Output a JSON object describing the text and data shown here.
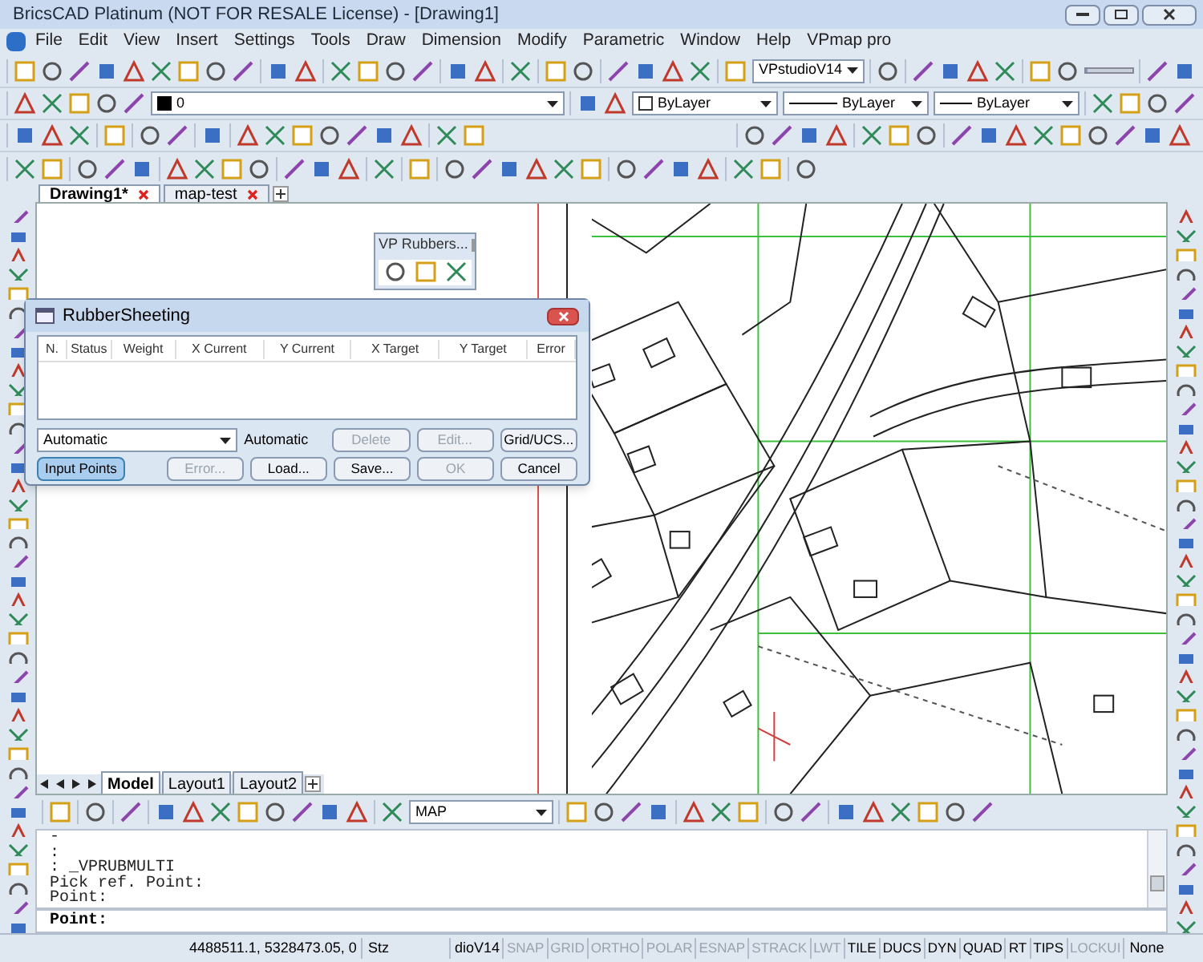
{
  "window": {
    "title": "BricsCAD Platinum (NOT FOR RESALE License) - [Drawing1]"
  },
  "menu": [
    "File",
    "Edit",
    "View",
    "Insert",
    "Settings",
    "Tools",
    "Draw",
    "Dimension",
    "Modify",
    "Parametric",
    "Window",
    "Help",
    "VPmap pro"
  ],
  "toolbar": {
    "style_dropdown": "VPstudioV14",
    "zoom_slider": {
      "level": 0.05
    },
    "layer_dropdown": "0",
    "color_dropdown": "ByLayer",
    "linetype_dropdown": "ByLayer",
    "lineweight_dropdown": "ByLayer"
  },
  "drawing_tabs": [
    {
      "label": "Drawing1*",
      "selected": true
    },
    {
      "label": "map-test",
      "selected": false
    }
  ],
  "floating_toolbar": {
    "title": "VP Rubbers..."
  },
  "dialog": {
    "title": "RubberSheeting",
    "columns": [
      "N.",
      "Status",
      "Weight",
      "X Current",
      "Y Current",
      "X Target",
      "Y Target",
      "Error"
    ],
    "mode_dropdown": "Automatic",
    "mode_label": "Automatic",
    "buttons_row_1": [
      {
        "label": "Delete",
        "disabled": true,
        "pressed": false
      },
      {
        "label": "Edit...",
        "disabled": true,
        "pressed": false
      },
      {
        "label": "Grid/UCS...",
        "disabled": false,
        "pressed": false
      }
    ],
    "buttons_row_2": [
      {
        "label": "Input Points",
        "disabled": false,
        "pressed": true
      },
      {
        "label": "Error...",
        "disabled": true,
        "pressed": false
      },
      {
        "label": "Load...",
        "disabled": false,
        "pressed": false
      },
      {
        "label": "Save...",
        "disabled": false,
        "pressed": false
      },
      {
        "label": "OK",
        "disabled": true,
        "pressed": false
      },
      {
        "label": "Cancel",
        "disabled": false,
        "pressed": false
      }
    ]
  },
  "layout_tabs": [
    {
      "label": "Model",
      "selected": true
    },
    {
      "label": "Layout1",
      "selected": false
    },
    {
      "label": "Layout2",
      "selected": false
    }
  ],
  "bottom_toolbar": {
    "dropdown": "MAP"
  },
  "command_history": [
    "-",
    ":",
    ": _VPRUBMULTI",
    "Pick ref. Point:",
    "Point:"
  ],
  "command_prompt": "Point:",
  "status_bar": {
    "coordinates": "4488511.1, 5328473.05, 0",
    "snap_mode": "Stz",
    "style": "dioV14",
    "toggles": [
      {
        "label": "SNAP",
        "on": false
      },
      {
        "label": "GRID",
        "on": false
      },
      {
        "label": "ORTHO",
        "on": false
      },
      {
        "label": "POLAR",
        "on": false
      },
      {
        "label": "ESNAP",
        "on": false
      },
      {
        "label": "STRACK",
        "on": false
      },
      {
        "label": "LWT",
        "on": false
      },
      {
        "label": "TILE",
        "on": true
      },
      {
        "label": "DUCS",
        "on": true
      },
      {
        "label": "DYN",
        "on": true
      },
      {
        "label": "QUAD",
        "on": true
      },
      {
        "label": "RT",
        "on": true
      },
      {
        "label": "TIPS",
        "on": true
      },
      {
        "label": "LOCKUI",
        "on": false
      }
    ],
    "units": "None"
  }
}
